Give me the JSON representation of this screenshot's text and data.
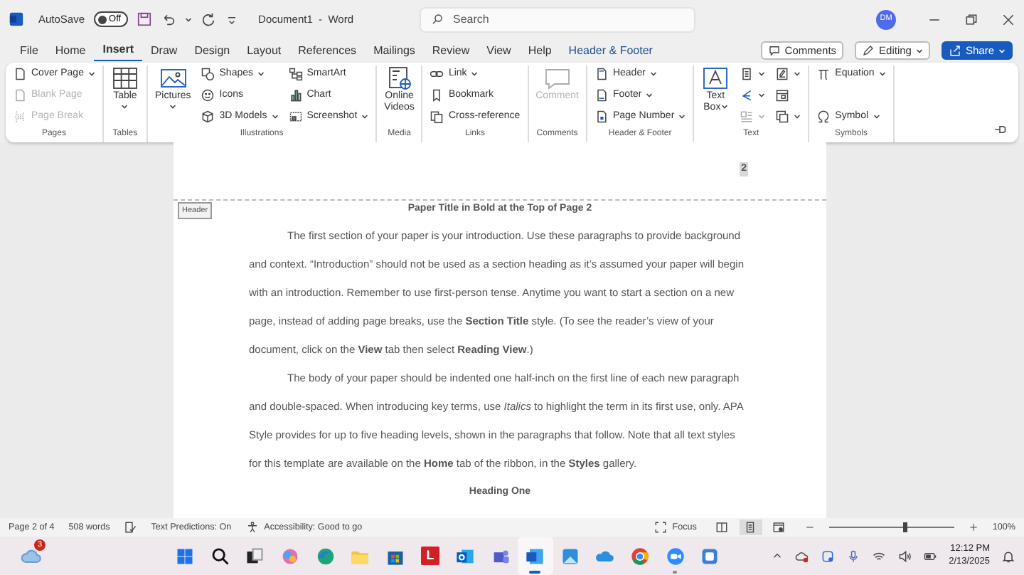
{
  "title_bar": {
    "autosave_label": "AutoSave",
    "autosave": {
      "label": "Off",
      "on": false
    },
    "document_title": "Document1  -  Word",
    "search": {
      "placeholder": "Search"
    },
    "avatar": "DM"
  },
  "ribbon_tabs": [
    {
      "label": "File",
      "selected": false,
      "kind": "standard"
    },
    {
      "label": "Home",
      "selected": false,
      "kind": "standard"
    },
    {
      "label": "Insert",
      "selected": true,
      "kind": "standard"
    },
    {
      "label": "Draw",
      "selected": false,
      "kind": "standard"
    },
    {
      "label": "Design",
      "selected": false,
      "kind": "standard"
    },
    {
      "label": "Layout",
      "selected": false,
      "kind": "standard"
    },
    {
      "label": "References",
      "selected": false,
      "kind": "standard"
    },
    {
      "label": "Mailings",
      "selected": false,
      "kind": "standard"
    },
    {
      "label": "Review",
      "selected": false,
      "kind": "standard"
    },
    {
      "label": "View",
      "selected": false,
      "kind": "standard"
    },
    {
      "label": "Help",
      "selected": false,
      "kind": "standard"
    },
    {
      "label": "Header & Footer",
      "selected": false,
      "kind": "contextual"
    }
  ],
  "ribbon_actions": [
    {
      "label": "Comments",
      "kind": "outline"
    },
    {
      "label": "Editing",
      "kind": "dropdown"
    },
    {
      "label": "Share",
      "kind": "primary"
    }
  ],
  "ribbon_groups": [
    {
      "label": "Pages",
      "columns": [
        [
          {
            "label": "Cover Page",
            "disabled": false,
            "dropdown": true
          },
          {
            "label": "Blank Page",
            "disabled": true,
            "dropdown": false
          },
          {
            "label": "Page Break",
            "disabled": true,
            "dropdown": false
          }
        ]
      ]
    },
    {
      "label": "Tables",
      "columns": [
        [
          {
            "label": "Table",
            "disabled": false,
            "dropdown": true
          }
        ]
      ]
    },
    {
      "label": "Illustrations",
      "columns": [
        [
          {
            "label": "Pictures",
            "disabled": false,
            "dropdown": true
          }
        ],
        [
          {
            "label": "Shapes",
            "disabled": false,
            "dropdown": true
          },
          {
            "label": "Icons",
            "disabled": false,
            "dropdown": false
          },
          {
            "label": "3D Models",
            "disabled": false,
            "dropdown": true
          }
        ],
        [
          {
            "label": "SmartArt",
            "disabled": false,
            "dropdown": false
          },
          {
            "label": "Chart",
            "disabled": false,
            "dropdown": false
          },
          {
            "label": "Screenshot",
            "disabled": false,
            "dropdown": true
          }
        ]
      ]
    },
    {
      "label": "Media",
      "columns": [
        [
          {
            "label": "Online Videos",
            "disabled": false,
            "dropdown": false
          }
        ]
      ]
    },
    {
      "label": "Links",
      "columns": [
        [
          {
            "label": "Link",
            "disabled": false,
            "dropdown": true
          },
          {
            "label": "Bookmark",
            "disabled": false,
            "dropdown": false
          },
          {
            "label": "Cross-reference",
            "disabled": false,
            "dropdown": false
          }
        ]
      ]
    },
    {
      "label": "Comments",
      "columns": [
        [
          {
            "label": "Comment",
            "disabled": true,
            "dropdown": false
          }
        ]
      ]
    },
    {
      "label": "Header & Footer",
      "columns": [
        [
          {
            "label": "Header",
            "disabled": false,
            "dropdown": true
          },
          {
            "label": "Footer",
            "disabled": false,
            "dropdown": true
          },
          {
            "label": "Page Number",
            "disabled": false,
            "dropdown": true
          }
        ]
      ]
    },
    {
      "label": "Text",
      "columns": [
        [
          {
            "label": "Text Box",
            "disabled": false,
            "dropdown": true
          }
        ],
        [
          {
            "disabled": false,
            "dropdown": true
          },
          {
            "disabled": false,
            "dropdown": true
          },
          {
            "disabled": true,
            "dropdown": true
          }
        ],
        [
          {
            "disabled": false,
            "dropdown": true
          },
          {
            "disabled": false,
            "dropdown": false
          },
          {
            "disabled": false,
            "dropdown": true
          }
        ]
      ]
    },
    {
      "label": "Symbols",
      "columns": [
        [
          {
            "label": "Equation",
            "disabled": false,
            "dropdown": true
          },
          {
            "label": "Symbol",
            "disabled": false,
            "dropdown": true
          }
        ]
      ]
    }
  ],
  "document": {
    "header_page_number": "2",
    "header_tag": "Header",
    "title": "Paper Title in Bold at the Top of Page 2",
    "paragraphs": [
      "The first section of your paper is your introduction. Use these paragraphs to provide background and context. “Introduction” should not be used as a section heading as it’s assumed your paper will begin with an introduction. Remember to use first-person tense. Anytime you want to start a section on a new page, instead of adding page breaks, use the **Section Title** style. (To see the reader’s view of your document, click on the **View** tab then select **Reading View**.)",
      "The body of your paper should be indented one half-inch on the first line of each new paragraph and double-spaced. When introducing key terms, use *Italics* to highlight the term in its first use, only. APA Style provides for up to five heading levels, shown in the paragraphs that follow. Note that all text styles for this template are available on the **Home** tab of the ribbon, in the **Styles** gallery."
    ],
    "heading": "Heading One"
  },
  "status_bar": {
    "page": "Page 2 of 4",
    "words": "508 words",
    "text_predictions": "Text Predictions: On",
    "accessibility": "Accessibility: Good to go",
    "focus": "Focus",
    "views": [
      {
        "selected": false
      },
      {
        "selected": true
      },
      {
        "selected": false
      }
    ],
    "zoom": {
      "level": 0.6,
      "reading": "100%"
    }
  },
  "taskbar": {
    "weather_badge": "3",
    "apps": [
      {
        "selected": false,
        "open": false
      },
      {
        "selected": false,
        "open": false
      },
      {
        "selected": false,
        "open": false
      },
      {
        "selected": false,
        "open": false
      },
      {
        "selected": false,
        "open": false
      },
      {
        "selected": false,
        "open": false
      },
      {
        "selected": false,
        "open": false
      },
      {
        "label": "L",
        "selected": false,
        "open": false
      },
      {
        "selected": false,
        "open": false
      },
      {
        "selected": false,
        "open": false
      },
      {
        "selected": true,
        "open": true
      },
      {
        "selected": false,
        "open": false
      },
      {
        "selected": false,
        "open": false
      },
      {
        "selected": false,
        "open": false
      },
      {
        "selected": false,
        "open": true
      },
      {
        "selected": false,
        "open": false
      }
    ],
    "time": "12:12 PM",
    "date": "2/13/2025"
  }
}
